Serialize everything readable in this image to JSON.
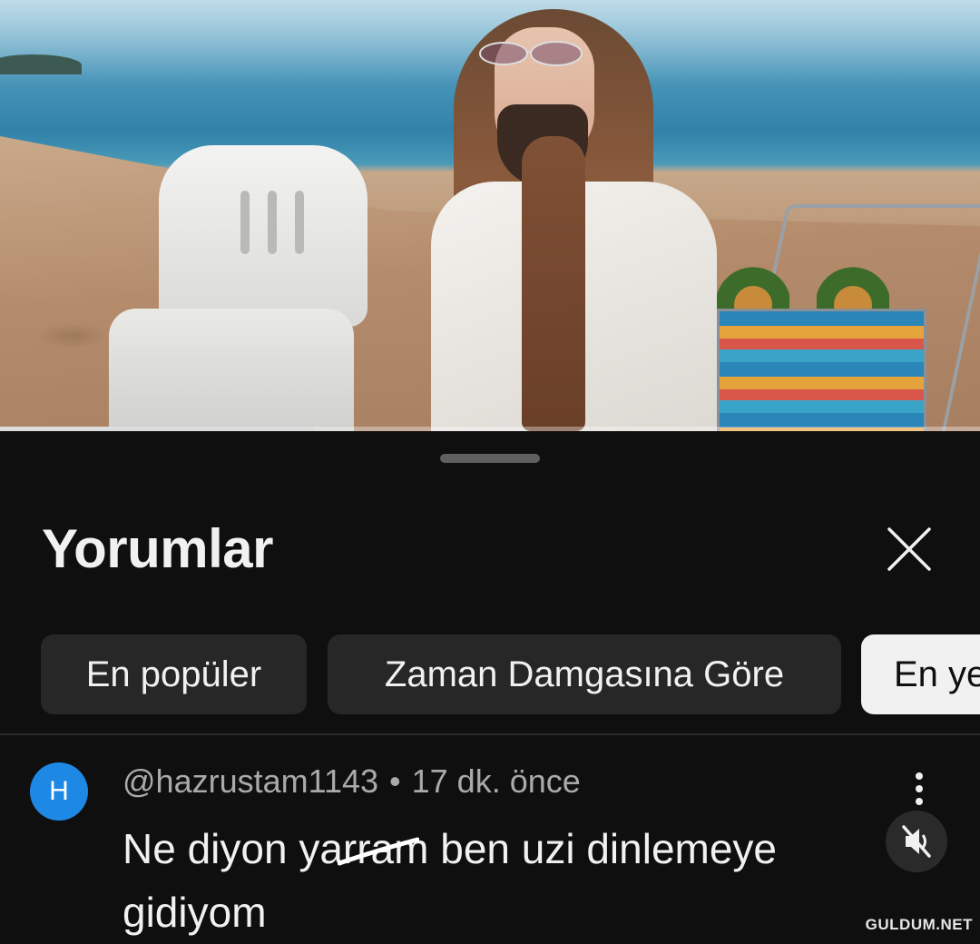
{
  "video": {
    "progress": 0.32,
    "progress_color": "#dcdcdc"
  },
  "comments_sheet": {
    "title": "Yorumlar",
    "close_icon": "close-icon",
    "sort_chips": [
      {
        "label": "En popüler",
        "selected": false
      },
      {
        "label": "Zaman Damgasına Göre",
        "selected": false
      },
      {
        "label": "En yeni",
        "selected": true
      }
    ]
  },
  "comment": {
    "avatar_letter": "H",
    "avatar_color": "#1e88e5",
    "author": "@hazrustam1143",
    "separator": "•",
    "time": "17 dk. önce",
    "text_line1": "Ne diyon yarram ben uzi dinlemeye",
    "text_line2": "gidiyom",
    "more_icon": "more-vertical-icon",
    "mute_icon": "volume-muted-icon"
  },
  "watermark": "GULDUM.NET"
}
